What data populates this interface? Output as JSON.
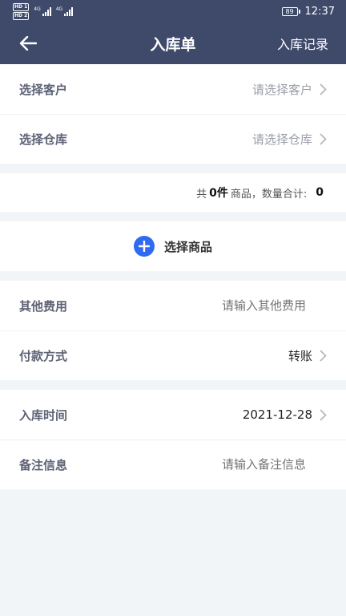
{
  "status_bar": {
    "hd1": "HD 1",
    "hd2": "HD 2",
    "net1": "4G",
    "net2": "4G",
    "battery": "89",
    "time": "12:37"
  },
  "navbar": {
    "back_icon": "arrow-left-icon",
    "title": "入库单",
    "action": "入库记录"
  },
  "section1": {
    "customer": {
      "label": "选择客户",
      "placeholder": "请选择客户"
    },
    "warehouse": {
      "label": "选择仓库",
      "placeholder": "请选择仓库"
    }
  },
  "summary": {
    "prefix": "共",
    "count": "0件",
    "middle": "商品，数量合计:",
    "total": "0"
  },
  "select_goods": {
    "icon": "plus-circle-icon",
    "label": "选择商品"
  },
  "section2": {
    "other_fees": {
      "label": "其他费用",
      "placeholder": "请输入其他费用"
    },
    "payment": {
      "label": "付款方式",
      "value": "转账"
    }
  },
  "section3": {
    "date": {
      "label": "入库时间",
      "value": "2021-12-28"
    },
    "notes": {
      "label": "备注信息",
      "placeholder": "请输入备注信息"
    }
  },
  "colors": {
    "header_bg": "#3f4a6b",
    "accent": "#2f6bf0",
    "page_bg": "#f2f5f8"
  }
}
